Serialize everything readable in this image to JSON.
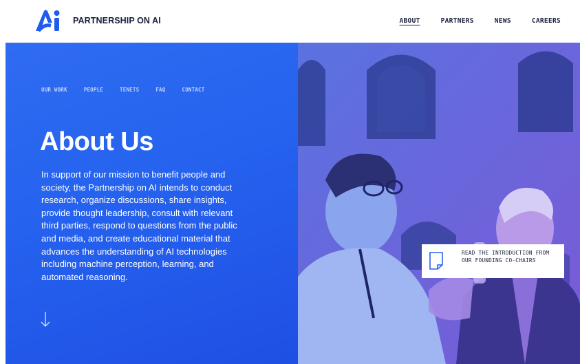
{
  "header": {
    "brand": "PARTNERSHIP ON AI",
    "logo_icon": "ai-logo-icon",
    "nav": [
      {
        "label": "ABOUT",
        "active": true
      },
      {
        "label": "PARTNERS",
        "active": false
      },
      {
        "label": "NEWS",
        "active": false
      },
      {
        "label": "CAREERS",
        "active": false
      }
    ]
  },
  "subnav": [
    "OUR WORK",
    "PEOPLE",
    "TENETS",
    "FAQ",
    "CONTACT"
  ],
  "hero": {
    "title": "About Us",
    "body": "In support of our mission to benefit people and society, the Partnership on AI intends to conduct research, organize discussions, share insights, provide thought leadership, consult with relevant third parties, respond to questions from the public and media, and create educational material that advances the understanding of AI technologies including machine perception, learning, and automated reasoning.",
    "scroll_icon": "arrow-down-icon"
  },
  "cta": {
    "text": "READ THE INTRODUCTION FROM OUR FOUNDING CO-CHAIRS",
    "icon": "document-icon"
  },
  "colors": {
    "hero_blue": "#2562ee",
    "photo_purple": "#6e4fd0",
    "text_dark": "#1a1f3a",
    "logo_blue": "#1e5bf0"
  }
}
